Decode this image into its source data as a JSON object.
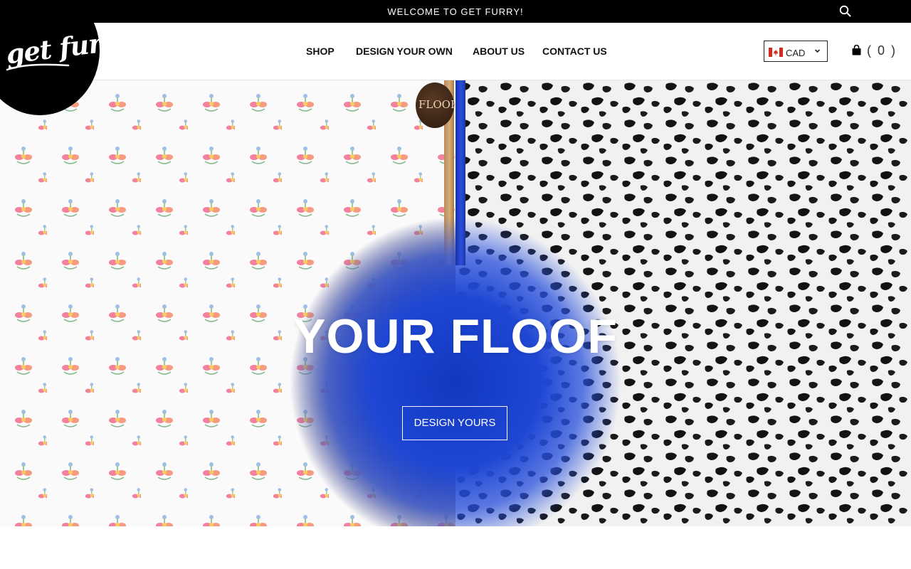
{
  "topbar": {
    "welcome": "WELCOME TO GET FURRY!",
    "search_icon": "search-icon"
  },
  "logo": {
    "text": "get furry"
  },
  "nav": [
    {
      "label": "SHOP"
    },
    {
      "label": "DESIGN YOUR OWN"
    },
    {
      "label": "ABOUT US"
    },
    {
      "label": "CONTACT US"
    }
  ],
  "currency": {
    "selected": "CAD",
    "flag_icon": "canada-flag-icon"
  },
  "cart": {
    "count_label": "( 0 )",
    "icon": "shopping-bag-icon"
  },
  "hero": {
    "tag_text": "FLOOF",
    "title": "YOUR FLOOF",
    "button_label": "DESIGN YOURS"
  },
  "colors": {
    "topbar_bg": "#000000",
    "accent_blue": "#1f47d4",
    "accent_brown": "#7b5e42",
    "text_dark": "#111111"
  }
}
